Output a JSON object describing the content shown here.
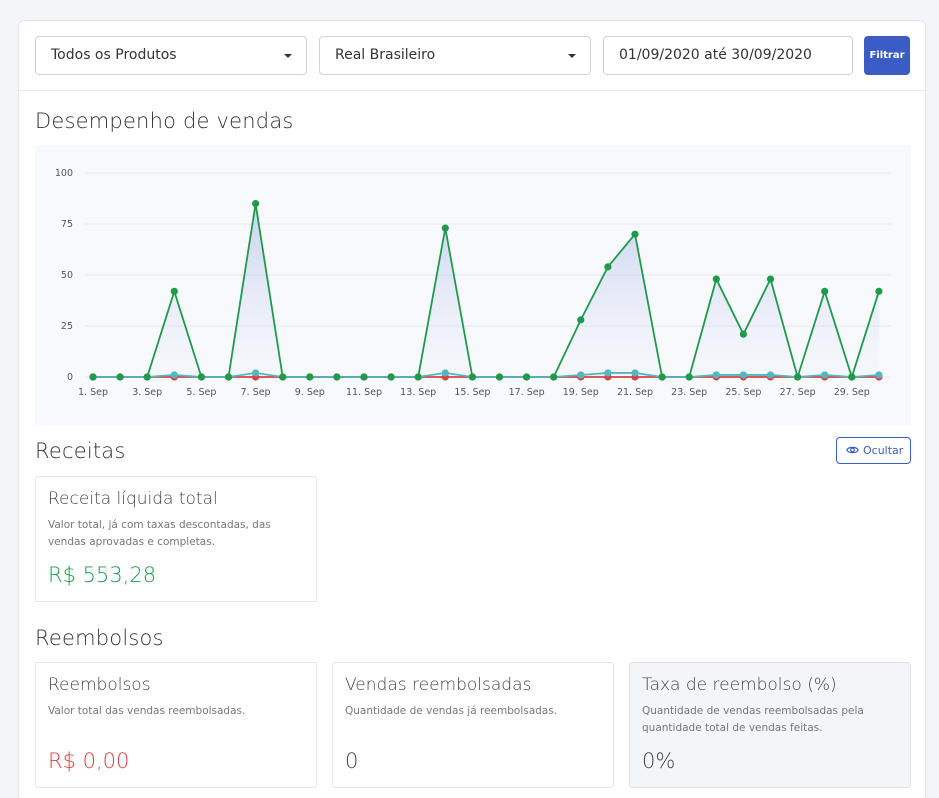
{
  "filters": {
    "product": "Todos os Produtos",
    "currency": "Real Brasileiro",
    "date_range": "01/09/2020 até 30/09/2020",
    "filter_button": "Filtrar"
  },
  "sales": {
    "title": "Desempenho de vendas"
  },
  "chart_data": {
    "type": "area",
    "categories": [
      "1. Sep",
      "2. Sep",
      "3. Sep",
      "4. Sep",
      "5. Sep",
      "6. Sep",
      "7. Sep",
      "8. Sep",
      "9. Sep",
      "10. Sep",
      "11. Sep",
      "12. Sep",
      "13. Sep",
      "14. Sep",
      "15. Sep",
      "16. Sep",
      "17. Sep",
      "18. Sep",
      "19. Sep",
      "20. Sep",
      "21. Sep",
      "22. Sep",
      "23. Sep",
      "24. Sep",
      "25. Sep",
      "26. Sep",
      "27. Sep",
      "28. Sep",
      "29. Sep",
      "30. Sep"
    ],
    "x_tick_labels": [
      "1. Sep",
      "3. Sep",
      "5. Sep",
      "7. Sep",
      "9. Sep",
      "11. Sep",
      "13. Sep",
      "15. Sep",
      "17. Sep",
      "19. Sep",
      "21. Sep",
      "23. Sep",
      "25. Sep",
      "27. Sep",
      "29. Sep"
    ],
    "y_ticks": [
      0,
      25,
      50,
      75,
      100
    ],
    "ylim": [
      0,
      100
    ],
    "grid": true,
    "series": [
      {
        "color": "#1f9a4b",
        "values": [
          0,
          0,
          0,
          42,
          0,
          0,
          85,
          0,
          0,
          0,
          0,
          0,
          0,
          73,
          0,
          0,
          0,
          0,
          28,
          54,
          70,
          0,
          0,
          48,
          21,
          48,
          0,
          42,
          0,
          42
        ]
      },
      {
        "color": "#d94040",
        "values": [
          0,
          0,
          0,
          0,
          0,
          0,
          0,
          0,
          0,
          0,
          0,
          0,
          0,
          0,
          0,
          0,
          0,
          0,
          0,
          0,
          0,
          0,
          0,
          0,
          0,
          0,
          0,
          0,
          0,
          0
        ]
      },
      {
        "color": "#4fb8c0",
        "values": [
          0,
          0,
          0,
          1,
          0,
          0,
          2,
          0,
          0,
          0,
          0,
          0,
          0,
          2,
          0,
          0,
          0,
          0,
          1,
          2,
          2,
          0,
          0,
          1,
          1,
          1,
          0,
          1,
          0,
          1
        ]
      }
    ]
  },
  "revenue": {
    "title": "Receitas",
    "hide_button": "Ocultar",
    "card": {
      "title": "Receita líquida total",
      "description": "Valor total, já com taxas descontadas, das vendas aprovadas e completas.",
      "value": "R$ 553,28"
    }
  },
  "refunds": {
    "title": "Reembolsos",
    "cards": [
      {
        "title": "Reembolsos",
        "description": "Valor total das vendas reembolsadas.",
        "value": "R$ 0,00"
      },
      {
        "title": "Vendas reembolsadas",
        "description": "Quantidade de vendas já reembolsadas.",
        "value": "0"
      },
      {
        "title": "Taxa de reembolso (%)",
        "description": "Quantidade de vendas reembolsadas pela quantidade total de vendas feitas.",
        "value": "0%"
      }
    ]
  },
  "colors": {
    "primary": "#3b5cc4",
    "positive": "#1f9a4b",
    "negative": "#d94040",
    "tertiary": "#4fb8c0"
  }
}
